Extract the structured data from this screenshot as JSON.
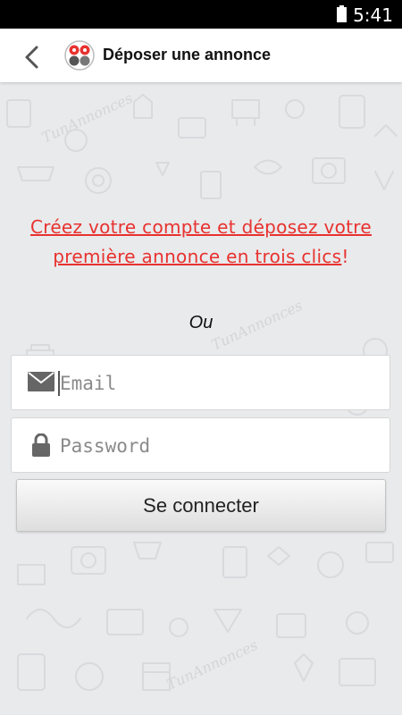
{
  "status_bar": {
    "time": "5:41"
  },
  "app_bar": {
    "title": "Déposer une annonce"
  },
  "background": {
    "watermark": "TunAnnonces"
  },
  "promo": {
    "text": "Créez votre compte et déposez votre première annonce en trois clics",
    "suffix": "!",
    "color": "#e8322f"
  },
  "separator": {
    "text": "Ou"
  },
  "form": {
    "email": {
      "placeholder": "Email",
      "value": ""
    },
    "password": {
      "placeholder": "Password",
      "value": ""
    },
    "submit_label": "Se connecter"
  }
}
